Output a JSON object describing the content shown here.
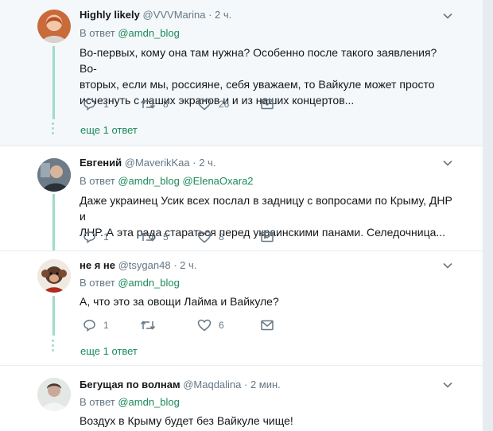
{
  "reply_prefix": "В ответ",
  "tweets": [
    {
      "name": "Highly likely",
      "handle": "@VVVMarina",
      "time": "· 2 ч.",
      "mentions": "@amdn_blog",
      "lines": [
        "Во-первых, кому она там нужна? Особенно после такого заявления? Во-",
        "вторых, если мы, россияне, себя уважаем, то Вайкуле может просто",
        "исчезнуть с наших экранов и и из наших концертов..."
      ],
      "replies": "1",
      "retweets": "8",
      "likes": "26",
      "more_replies": "еще 1 ответ"
    },
    {
      "name": "Евгений",
      "handle": "@MaverikKaa",
      "time": "· 2 ч.",
      "mentions": "@amdn_blog @ElenaOxara2",
      "lines": [
        "Даже украинец Усик всех послал в задницу с вопросами по Крыму, ДНР и",
        "ЛНР. А эта рада стараться перед украинскими панами. Селедочница..."
      ],
      "replies": "1",
      "retweets": "5",
      "likes": "8"
    },
    {
      "name": "не я не",
      "handle": "@tsygan48",
      "time": "· 2 ч.",
      "mentions": "@amdn_blog",
      "lines": [
        "А, что это за овощи Лайма и Вайкуле?"
      ],
      "replies": "1",
      "retweets": "",
      "likes": "6",
      "more_replies": "еще 1 ответ"
    },
    {
      "name": "Бегущая по волнам",
      "handle": "@Maqdalina",
      "time": "· 2 мин.",
      "mentions": "@amdn_blog",
      "lines": [
        "Воздух в Крыму будет без Вайкуле чище!"
      ]
    }
  ],
  "icons": {
    "reply": "reply-icon",
    "retweet": "retweet-icon",
    "like": "heart-icon",
    "dm": "envelope-icon",
    "menu": "chevron-down-icon"
  },
  "colors": {
    "accent": "#1b8a5a",
    "thread": "#9fdcc3",
    "muted": "#657786",
    "highlight": "#f5f8fa"
  }
}
